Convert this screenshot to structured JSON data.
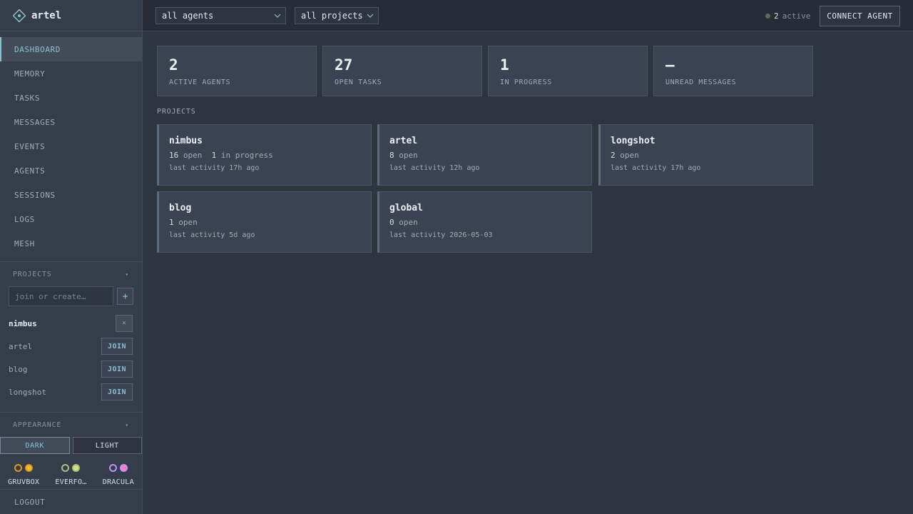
{
  "app": {
    "name": "artel"
  },
  "nav": {
    "items": [
      {
        "label": "DASHBOARD",
        "active": true
      },
      {
        "label": "MEMORY"
      },
      {
        "label": "TASKS"
      },
      {
        "label": "MESSAGES"
      },
      {
        "label": "EVENTS"
      },
      {
        "label": "AGENTS"
      },
      {
        "label": "SESSIONS"
      },
      {
        "label": "LOGS"
      },
      {
        "label": "MESH"
      }
    ]
  },
  "sidebar_projects": {
    "heading": "PROJECTS",
    "input_placeholder": "join or create…",
    "add_label": "+",
    "current": {
      "name": "nimbus",
      "leave_label": "×"
    },
    "others": [
      {
        "name": "artel",
        "action": "JOIN"
      },
      {
        "name": "blog",
        "action": "JOIN"
      },
      {
        "name": "longshot",
        "action": "JOIN"
      }
    ]
  },
  "appearance": {
    "heading": "APPEARANCE",
    "modes": [
      {
        "label": "DARK",
        "active": true
      },
      {
        "label": "LIGHT"
      }
    ],
    "themes": [
      {
        "label": "GRUVBOX",
        "colors": [
          "#d79921",
          "#fabd2f"
        ]
      },
      {
        "label": "EVERFO…",
        "colors": [
          "#a7c080",
          "#dbe07a"
        ]
      },
      {
        "label": "DRACULA",
        "colors": [
          "#bd93f9",
          "#ff79c6"
        ]
      }
    ]
  },
  "logout_label": "LOGOUT",
  "topbar": {
    "agent_filter": "all agents",
    "project_filter": "all projects",
    "active_count": "2",
    "active_label": "active",
    "connect_label": "CONNECT AGENT"
  },
  "stats": [
    {
      "value": "2",
      "label": "ACTIVE AGENTS"
    },
    {
      "value": "27",
      "label": "OPEN TASKS"
    },
    {
      "value": "1",
      "label": "IN PROGRESS"
    },
    {
      "value": "—",
      "label": "UNREAD MESSAGES"
    }
  ],
  "projects_title": "PROJECTS",
  "projects": [
    {
      "name": "nimbus",
      "open_count": "16",
      "open_label": "open",
      "progress_count": "1",
      "progress_label": "in progress",
      "activity": "last activity 17h ago"
    },
    {
      "name": "artel",
      "open_count": "8",
      "open_label": "open",
      "activity": "last activity 12h ago"
    },
    {
      "name": "longshot",
      "open_count": "2",
      "open_label": "open",
      "activity": "last activity 17h ago"
    },
    {
      "name": "blog",
      "open_count": "1",
      "open_label": "open",
      "activity": "last activity 5d ago"
    },
    {
      "name": "global",
      "open_count": "0",
      "open_label": "open",
      "activity": "last activity 2026-05-03"
    }
  ],
  "colors": {
    "accent": "#88c0d0",
    "background": "#2e3440",
    "card": "#3b4252"
  }
}
